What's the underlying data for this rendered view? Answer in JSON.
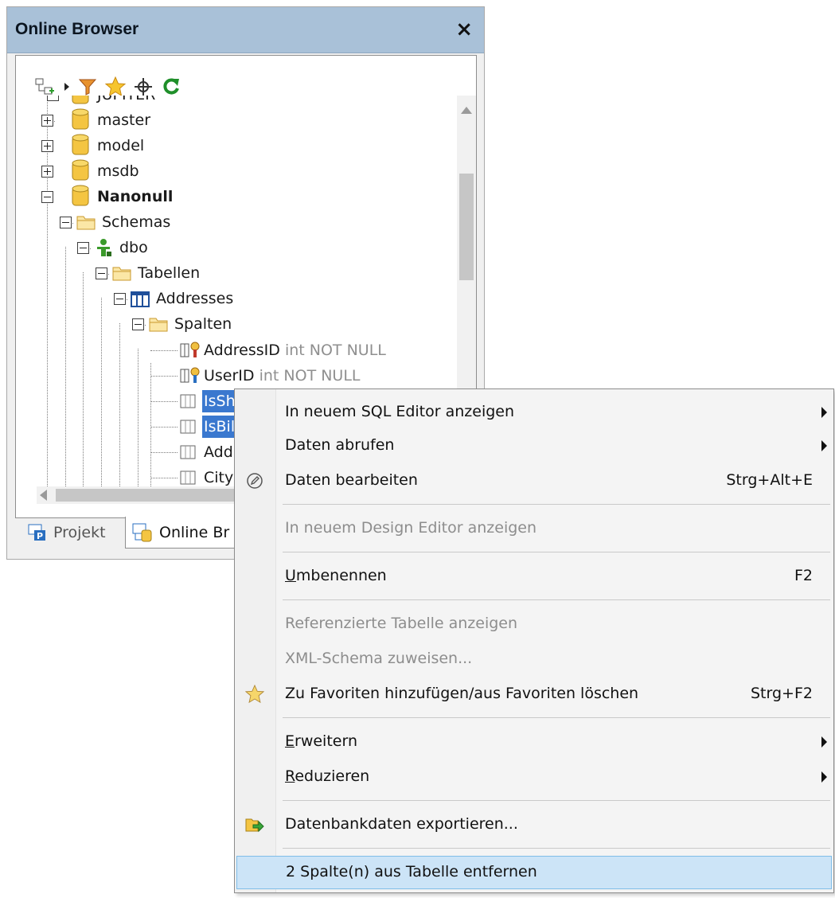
{
  "panel": {
    "title": "Online Browser",
    "close_glyph": "×",
    "toolbar_icons": [
      "add-connection-icon",
      "dropdown-arrow-icon",
      "filter-icon",
      "favorite-star-icon",
      "locate-icon",
      "refresh-icon"
    ]
  },
  "tree": {
    "items": [
      {
        "label": "JUPITER",
        "type": "database"
      },
      {
        "label": "master",
        "type": "database"
      },
      {
        "label": "model",
        "type": "database"
      },
      {
        "label": "msdb",
        "type": "database"
      },
      {
        "label": "Nanonull",
        "type": "database"
      },
      {
        "label": "Schemas",
        "type": "folder"
      },
      {
        "label": "dbo",
        "type": "schema"
      },
      {
        "label": "Tabellen",
        "type": "folder"
      },
      {
        "label": "Addresses",
        "type": "table"
      },
      {
        "label": "Spalten",
        "type": "folder"
      },
      {
        "label": "AddressID",
        "dtype": "int NOT NULL",
        "type": "pk-column"
      },
      {
        "label": "UserID",
        "dtype": "int NOT NULL",
        "type": "fk-column"
      },
      {
        "label": "IsShi",
        "type": "column",
        "selected": true
      },
      {
        "label": "IsBilli",
        "type": "column",
        "selected": true
      },
      {
        "label": "Addr",
        "type": "column"
      },
      {
        "label": "City",
        "type": "column"
      }
    ]
  },
  "tabs": [
    {
      "label": "Projekt",
      "active": false
    },
    {
      "label": "Online Br",
      "active": true
    }
  ],
  "context_menu": {
    "items": [
      {
        "label": "In neuem SQL Editor anzeigen",
        "submenu": true
      },
      {
        "label": "Daten abrufen",
        "submenu": true
      },
      {
        "label": "Daten bearbeiten",
        "shortcut": "Strg+Alt+E",
        "icon": "edit-pencil-icon"
      },
      {
        "label": "In neuem Design Editor anzeigen",
        "disabled": true
      },
      {
        "label_prefix": "U",
        "label_rest": "mbenennen",
        "shortcut": "F2"
      },
      {
        "label": "Referenzierte Tabelle anzeigen",
        "disabled": true
      },
      {
        "label": "XML-Schema zuweisen...",
        "disabled": true
      },
      {
        "label": "Zu Favoriten hinzufügen/aus Favoriten löschen",
        "shortcut": "Strg+F2",
        "icon": "favorite-star-icon"
      },
      {
        "label_prefix": "E",
        "label_rest": "rweitern",
        "submenu": true
      },
      {
        "label_prefix": "R",
        "label_rest": "eduzieren",
        "submenu": true
      },
      {
        "label": "Datenbankdaten exportieren...",
        "icon": "export-icon"
      },
      {
        "label": "2 Spalte(n) aus Tabelle entfernen",
        "highlighted": true
      }
    ]
  },
  "colors": {
    "title_bar": "#a9c1d8",
    "selection": "#3a78cf",
    "menu_highlight": "#cce4f7",
    "database_icon": "#f4c542"
  }
}
